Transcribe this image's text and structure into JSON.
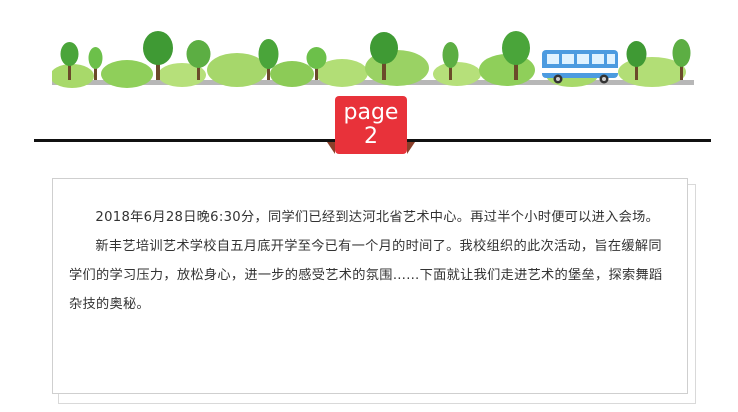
{
  "page_tag": {
    "word": "page",
    "number": "2"
  },
  "colors": {
    "tag_red": "#e8323a",
    "divider": "#111111",
    "tree_green": "#5cae43",
    "bus_blue": "#4c9be0"
  },
  "article": {
    "paragraphs": [
      "2018年6月28日晚6:30分，同学们已经到达河北省艺术中心。再过半个小时便可以进入会场。",
      "新丰艺培训艺术学校自五月底开学至今已有一个月的时间了。我校组织的此次活动，旨在缓解同学们的学习压力，放松身心，进一步的感受艺术的氛围……下面就让我们走进艺术的堡垒，探索舞蹈杂技的奥秘。"
    ]
  },
  "banner_icons": [
    "tree-icon",
    "bush-icon",
    "bus-icon"
  ]
}
